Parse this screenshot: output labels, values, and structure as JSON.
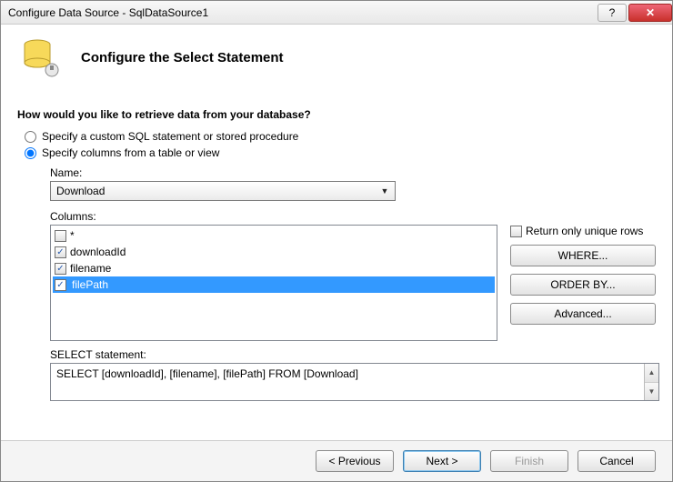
{
  "titlebar": {
    "text": "Configure Data Source - SqlDataSource1",
    "help_symbol": "?",
    "close_symbol": "✕"
  },
  "header": {
    "title": "Configure the Select Statement"
  },
  "question": "How would you like to retrieve data from your database?",
  "radios": {
    "custom": "Specify a custom SQL statement or stored procedure",
    "columns": "Specify columns from a table or view",
    "selected": "columns"
  },
  "name_label": "Name:",
  "table_name": "Download",
  "columns_label": "Columns:",
  "columns": [
    {
      "label": "*",
      "checked": false,
      "selected": false
    },
    {
      "label": "downloadId",
      "checked": true,
      "selected": false
    },
    {
      "label": "filename",
      "checked": true,
      "selected": false
    },
    {
      "label": "filePath",
      "checked": true,
      "selected": true
    }
  ],
  "unique_label": "Return only unique rows",
  "unique_checked": false,
  "buttons": {
    "where": "WHERE...",
    "orderby": "ORDER BY...",
    "advanced": "Advanced..."
  },
  "stmt_label": "SELECT statement:",
  "stmt_value": "SELECT [downloadId], [filename], [filePath] FROM [Download]",
  "footer": {
    "previous": "< Previous",
    "next": "Next >",
    "finish": "Finish",
    "cancel": "Cancel"
  }
}
